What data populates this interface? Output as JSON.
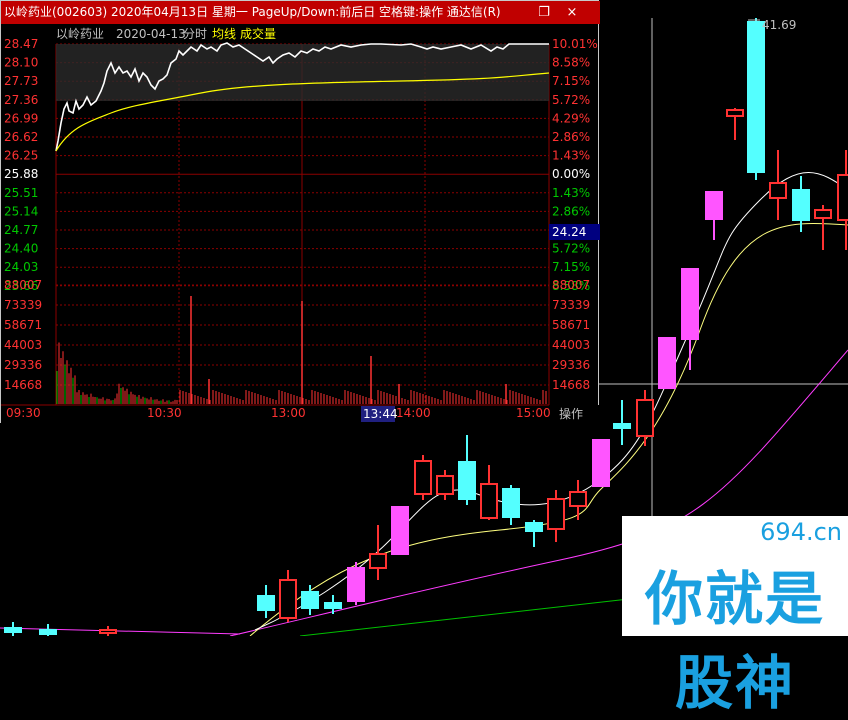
{
  "window": {
    "title": "以岭药业(002603) 2020年04月13日 星期一 PageUp/Down:前后日 空格键:操作 通达信(R)",
    "restore_glyph": "❐",
    "close_glyph": "×"
  },
  "intraday": {
    "stock_name": "以岭药业",
    "date": "2020-04-13",
    "mode_label": "分时",
    "avg_line_label": "均线",
    "volume_label": "成交量",
    "operate_label": "操作",
    "current_price_tag": "24.24",
    "cursor_time": "13:44",
    "price_labels": [
      "28.47",
      "28.10",
      "27.73",
      "27.36",
      "26.99",
      "26.62",
      "26.25",
      "25.88",
      "25.51",
      "25.14",
      "24.77",
      "24.40",
      "24.03",
      "23.66"
    ],
    "pct_labels": [
      "10.01%",
      "8.58%",
      "7.15%",
      "5.72%",
      "4.29%",
      "2.86%",
      "1.43%",
      "0.00%",
      "1.43%",
      "2.86%",
      "4.29%",
      "5.72%",
      "7.15%",
      "8.58%"
    ],
    "volume_labels": [
      "88007",
      "73339",
      "58671",
      "44003",
      "29336",
      "14668"
    ],
    "time_labels": [
      "09:30",
      "10:30",
      "13:00",
      "14:00",
      "15:00"
    ],
    "colors": {
      "up": "#ff3232",
      "down": "#00c800",
      "flat": "#ffffff",
      "price_line": "#ffffff",
      "avg_line": "#ffff00",
      "grid": "#8b0000"
    }
  },
  "kline": {
    "high_label": "41.69",
    "colors": {
      "up_body": "#ff55ff",
      "up_border": "#ff3232",
      "down_body": "#54ffff",
      "ma5": "#ffffff",
      "ma10": "#ffff80",
      "ma20": "#ff3cff",
      "ma60": "#00c000"
    }
  },
  "watermark": {
    "domain": "694.cn",
    "text": "你就是股神"
  }
}
